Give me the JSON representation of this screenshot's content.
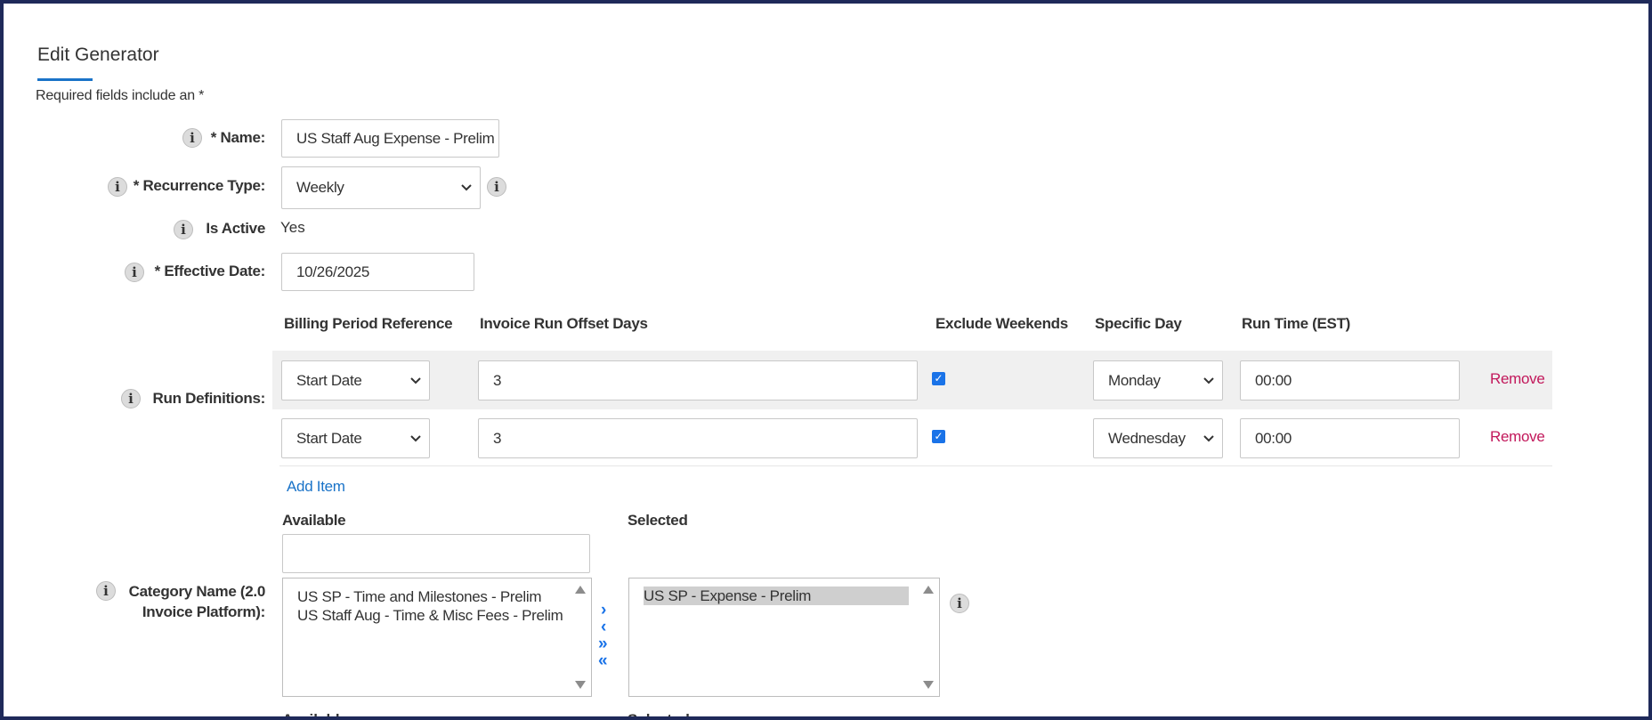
{
  "form": {
    "title": "Edit Generator",
    "required_note": "Required fields include an *",
    "name": {
      "label": "* Name:",
      "value": "US Staff Aug Expense - Prelim"
    },
    "recurrence_type": {
      "label": "* Recurrence Type:",
      "value": "Weekly"
    },
    "is_active": {
      "label": "Is Active",
      "value": "Yes"
    },
    "effective_date": {
      "label": "* Effective Date:",
      "value": "10/26/2025"
    }
  },
  "run_definitions": {
    "label": "Run Definitions:",
    "columns": [
      "Billing Period Reference",
      "Invoice Run Offset Days",
      "Exclude Weekends",
      "Specific Day",
      "Run Time (EST)"
    ],
    "rows": [
      {
        "billing_period": "Start Date",
        "offset_days": "3",
        "exclude_weekends": true,
        "specific_day": "Monday",
        "run_time": "00:00",
        "remove": "Remove"
      },
      {
        "billing_period": "Start Date",
        "offset_days": "3",
        "exclude_weekends": true,
        "specific_day": "Wednesday",
        "run_time": "00:00",
        "remove": "Remove"
      }
    ],
    "add_item": "Add Item"
  },
  "category": {
    "label_line1": "Category Name (2.0",
    "label_line2": "Invoice Platform):",
    "available_label": "Available",
    "selected_label": "Selected",
    "filter_value": "",
    "available": [
      "US SP - Time and Milestones - Prelim",
      "US Staff Aug - Time & Misc Fees - Prelim"
    ],
    "selected": [
      "US SP - Expense - Prelim"
    ],
    "buttons": {
      "move_right": "›",
      "move_left": "‹",
      "move_all_right": "»",
      "move_all_left": "«"
    }
  },
  "next_section": {
    "available_label": "Available",
    "selected_label": "Selected"
  },
  "icons": {
    "info": "i",
    "check": "✓"
  },
  "colors": {
    "accent": "#1a73c8",
    "remove": "#c2185b",
    "frame": "#1f2a5a",
    "checkbox": "#1a73e8"
  }
}
